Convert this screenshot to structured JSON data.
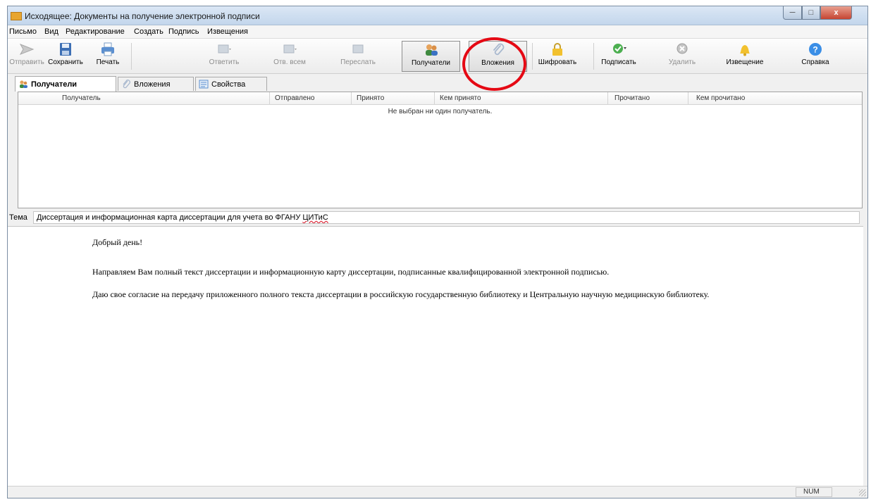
{
  "window": {
    "title": "Исходящее: Документы на получение электронной подписи",
    "min_glyph": "─",
    "max_glyph": "□",
    "close_glyph": "x"
  },
  "menu": [
    "Письмо",
    "Вид",
    "Редактирование",
    "Создать",
    "Подпись",
    "Извещения"
  ],
  "toolbar": {
    "send": "Отправить",
    "save": "Сохранить",
    "print": "Печать",
    "reply": "Ответить",
    "reply_all": "Отв. всем",
    "forward": "Переслать",
    "recipients": "Получатели",
    "attachments": "Вложения",
    "encrypt": "Шифровать",
    "sign": "Подписать",
    "delete": "Удалить",
    "notice": "Извещение",
    "help": "Справка",
    "help_glyph": "?"
  },
  "tabs": [
    "Получатели",
    "Вложения",
    "Свойства"
  ],
  "grid": {
    "columns": [
      "Получатель",
      "Отправлено",
      "Принято",
      "Кем принято",
      "Прочитано",
      "Кем прочитано"
    ],
    "empty_message": "Не выбран ни один получатель."
  },
  "subject": {
    "label": "Тема",
    "value_main": "Диссертация и информационная карта диссертации для учета во ФГАНУ ",
    "value_misspelled": "ЦИТиС"
  },
  "message": {
    "greeting": "Добрый день!",
    "paragraph1": "Направляем Вам полный текст диссертации и информационную карту диссертации, подписанные квалифицированной электронной подписью.",
    "paragraph2": "Даю свое согласие на передачу приложенного полного текста диссертации в российскую государственную библиотеку и Центральную научную медицинскую библиотеку."
  },
  "status": {
    "num": "NUM"
  },
  "colors": {
    "highlight_ring": "#e50914",
    "sign_green": "#4caf50",
    "help_blue": "#3a8ee6",
    "notice_yellow": "#f2c12e"
  }
}
